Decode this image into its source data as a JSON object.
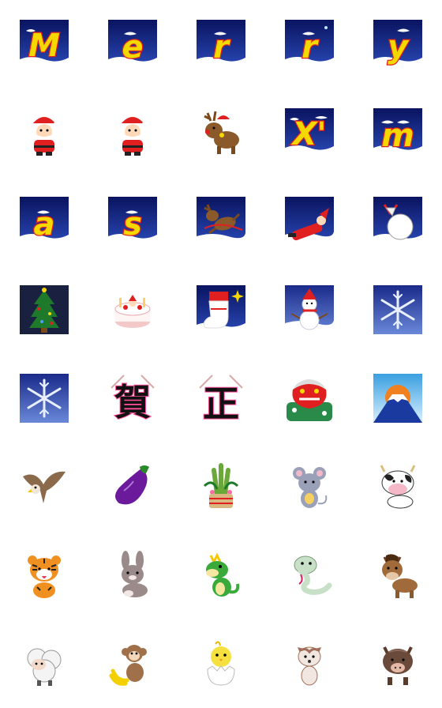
{
  "letters": {
    "m": "M",
    "e": "e",
    "r1": "r",
    "r2": "r",
    "y": "y",
    "x": "X'",
    "mm": "m",
    "a": "a",
    "s": "s"
  },
  "kanji": {
    "ga": "賀",
    "sho": "正"
  },
  "colors": {
    "night_sky": "#0c1a78",
    "letter_fill": "#f5d800",
    "letter_outline": "#e02020",
    "snow": "#ffffff"
  }
}
